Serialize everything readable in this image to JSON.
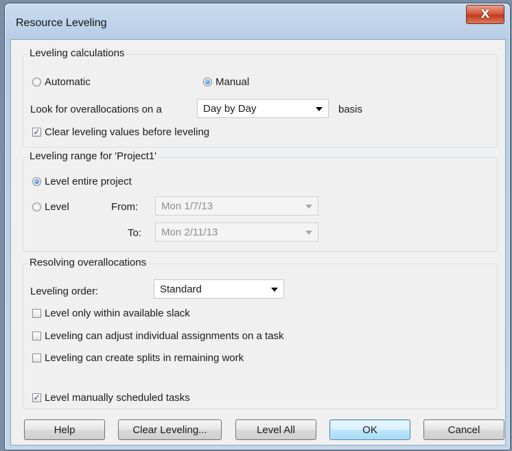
{
  "window": {
    "title": "Resource Leveling",
    "close_glyph": "X"
  },
  "calc": {
    "legend": "Leveling calculations",
    "automatic_label": "Automatic",
    "manual_label": "Manual",
    "selected_mode": "Manual",
    "look_prefix": "Look for overallocations on a",
    "basis_value": "Day by Day",
    "basis_suffix": "basis",
    "clear_values_label": "Clear leveling values before leveling",
    "clear_values_checked": true
  },
  "range": {
    "legend": "Leveling range for 'Project1'",
    "entire_label": "Level entire project",
    "level_label": "Level",
    "selected": "Level entire project",
    "from_label": "From:",
    "from_value": "Mon 1/7/13",
    "to_label": "To:",
    "to_value": "Mon 2/11/13"
  },
  "resolve": {
    "legend": "Resolving overallocations",
    "order_label": "Leveling order:",
    "order_value": "Standard",
    "opt_slack": "Level only within available slack",
    "opt_slack_checked": false,
    "opt_assignments": "Leveling can adjust individual assignments on a task",
    "opt_assignments_checked": false,
    "opt_splits": "Leveling can create splits in remaining work",
    "opt_splits_checked": false,
    "opt_manual": "Level manually scheduled tasks",
    "opt_manual_checked": true
  },
  "buttons": {
    "help": "Help",
    "clear_leveling": "Clear Leveling...",
    "level_all": "Level All",
    "ok": "OK",
    "cancel": "Cancel"
  },
  "icons": {
    "checkmark": "✓"
  }
}
